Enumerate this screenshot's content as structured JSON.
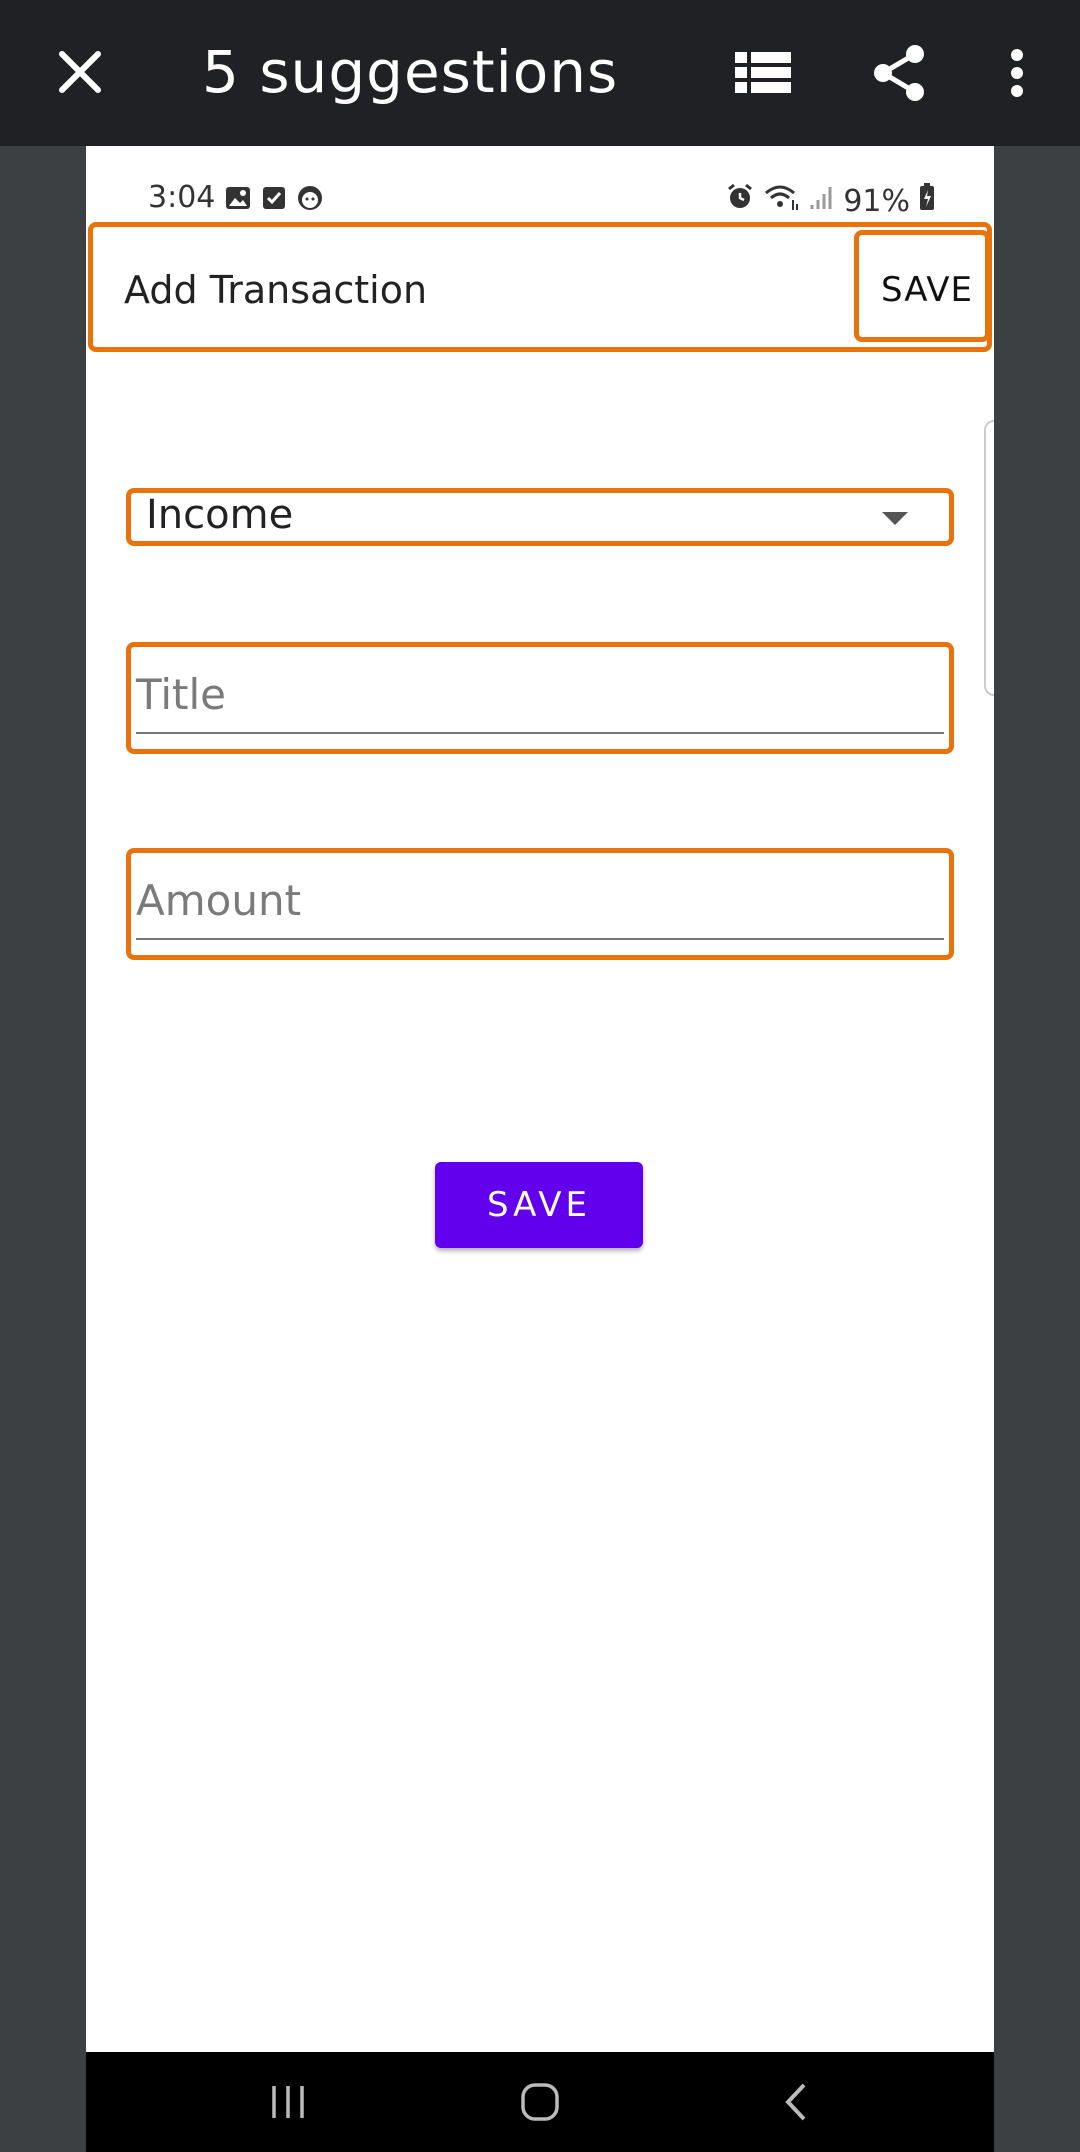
{
  "viewer": {
    "title": "5 suggestions",
    "icons": [
      "close-icon",
      "list-view-icon",
      "share-icon",
      "more-vert-icon"
    ]
  },
  "status_bar": {
    "time": "3:04",
    "battery": "91%",
    "left_icons": [
      "image-icon",
      "checkbox-icon",
      "face-icon"
    ],
    "right_icons": [
      "alarm-icon",
      "wifi-icon",
      "signal-icon",
      "battery-icon"
    ]
  },
  "app_bar": {
    "title": "Add Transaction",
    "save_label": "SAVE"
  },
  "form": {
    "type_selected": "Income",
    "title_placeholder": "Title",
    "amount_placeholder": "Amount",
    "save_button_label": "SAVE"
  },
  "nav_bar": {
    "icons": [
      "recents-icon",
      "home-icon",
      "back-icon"
    ]
  },
  "colors": {
    "highlight": "#e8730c",
    "primary_button": "#6200ee",
    "viewer_bar": "#202124"
  }
}
